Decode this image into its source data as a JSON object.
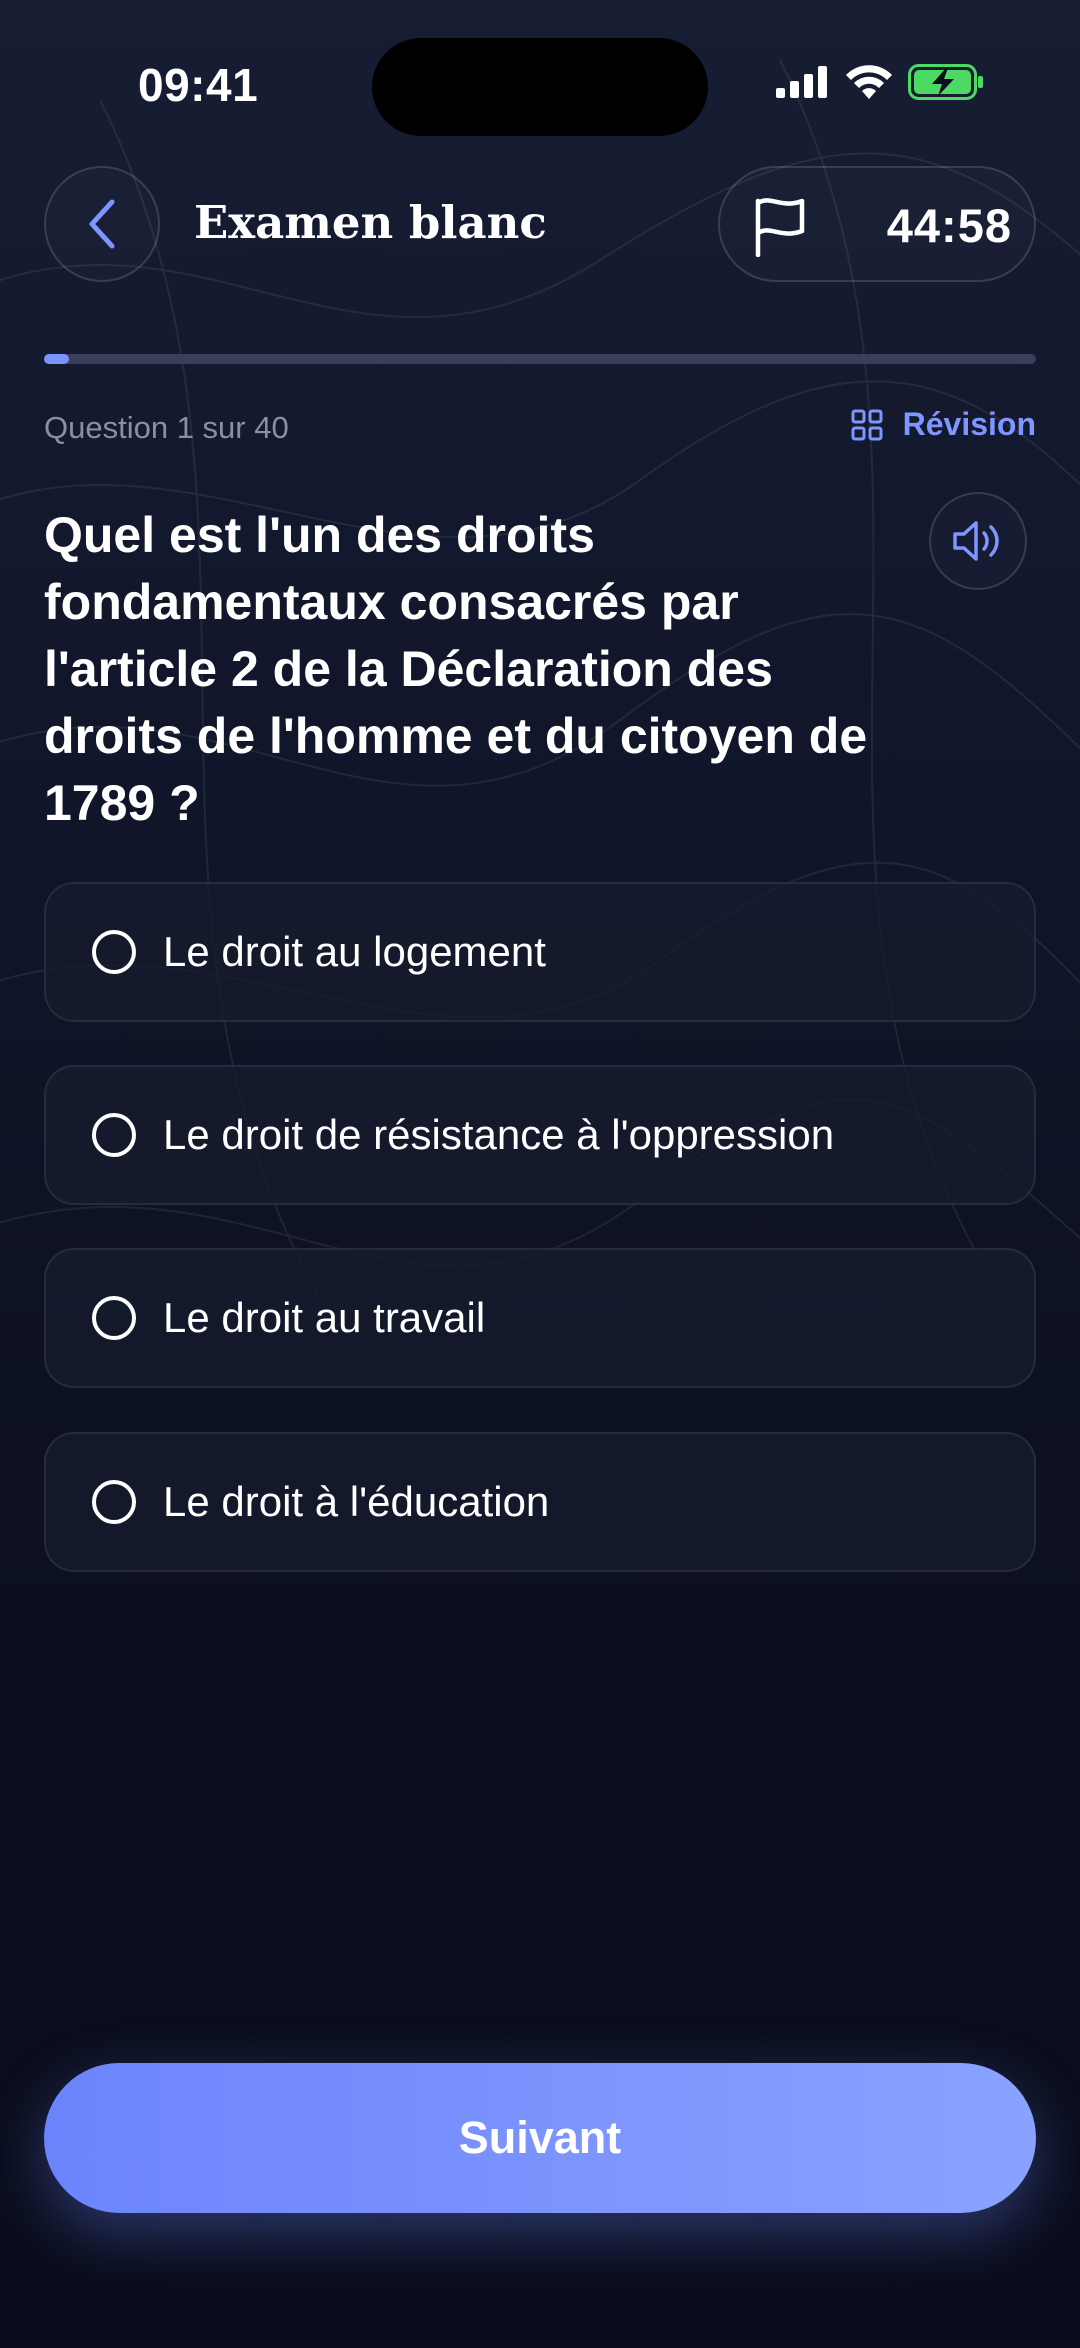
{
  "status_bar": {
    "time": "09:41",
    "icons": [
      "signal-icon",
      "wifi-icon",
      "battery-charging-icon"
    ],
    "battery_color": "#4cd964"
  },
  "header": {
    "back_icon": "chevron-left-icon",
    "title": "Examen blanc",
    "flag_icon": "flag-icon",
    "timer": "44:58"
  },
  "progress": {
    "current": 1,
    "total": 40,
    "fraction": 0.025,
    "label": "Question 1 sur 40"
  },
  "review": {
    "icon": "grid-icon",
    "label": "Révision"
  },
  "question": {
    "text": "Quel est l'un des droits fondamentaux consacrés par l'article 2 de la Déclaration des droits de l'homme et du citoyen de 1789 ?",
    "audio_icon": "speaker-icon"
  },
  "options": [
    {
      "label": "Le droit au logement",
      "selected": false
    },
    {
      "label": "Le droit de résistance à l'oppression",
      "selected": false
    },
    {
      "label": "Le droit au travail",
      "selected": false
    },
    {
      "label": "Le droit à l'éducation",
      "selected": false
    }
  ],
  "footer": {
    "next_label": "Suivant"
  },
  "colors": {
    "accent": "#7f95ff",
    "button_start": "#6c84fb",
    "button_end": "#8aa2ff",
    "background": "#0b0f1f"
  }
}
